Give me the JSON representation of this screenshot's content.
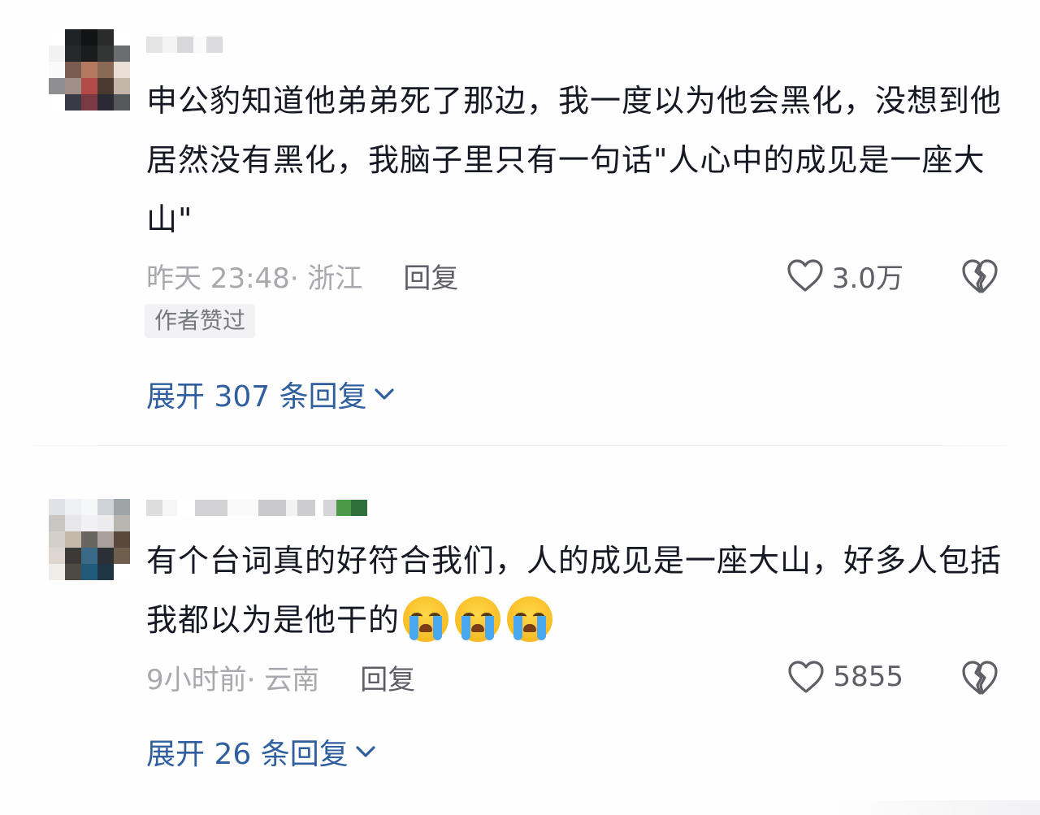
{
  "comments": [
    {
      "text": "申公豹知道他弟弟死了那边，我一度以为他会黑化，没想到他居然没有黑化，我脑子里只有一句话\"人心中的成见是一座大山\"",
      "time": "昨天 23:48",
      "location": "· 浙江",
      "reply_label": "回复",
      "likes": "3.0万",
      "author_liked_badge": "作者赞过",
      "expand_label": "展开 307 条回复"
    },
    {
      "text": "有个台词真的好符合我们，人的成见是一座大山，好多人包括我都以为是他干的",
      "emojis": [
        "loudly-crying-face",
        "loudly-crying-face",
        "loudly-crying-face"
      ],
      "time": "9小时前",
      "location": " · 云南",
      "reply_label": "回复",
      "likes": "5855",
      "expand_label": "展开 26 条回复"
    }
  ],
  "icons": {
    "like": "heart-outline-icon",
    "dislike": "broken-heart-icon",
    "expand": "chevron-down-icon"
  },
  "colors": {
    "text": "#161823",
    "meta": "#a8a8ae",
    "expand_link": "#2f5f9e",
    "badge_bg": "#f2f2f4"
  }
}
